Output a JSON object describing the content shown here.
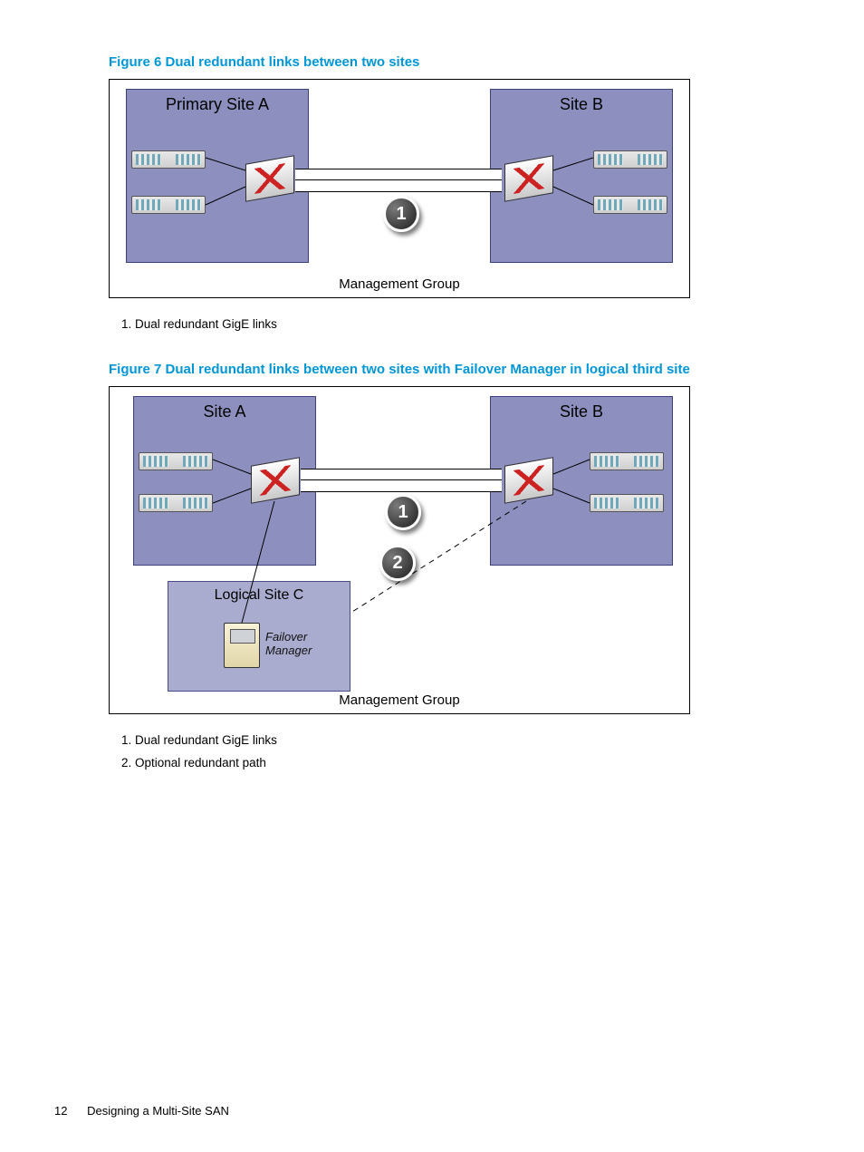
{
  "figure6": {
    "caption": "Figure 6 Dual redundant links between two sites",
    "siteA": "Primary Site A",
    "siteB": "Site B",
    "mgmt": "Management Group",
    "badge1": "1",
    "legend": {
      "item1": "1. Dual redundant GigE links"
    }
  },
  "figure7": {
    "caption": "Figure 7 Dual redundant links between two sites with Failover Manager in logical third site",
    "siteA": "Site A",
    "siteB": "Site B",
    "siteC": "Logical Site C",
    "fmLine1": "Failover",
    "fmLine2": "Manager",
    "mgmt": "Management Group",
    "badge1": "1",
    "badge2": "2",
    "legend": {
      "item1": "1. Dual redundant GigE links",
      "item2": "2. Optional redundant path"
    }
  },
  "footer": {
    "pageNumber": "12",
    "sectionTitle": "Designing a Multi-Site SAN"
  }
}
